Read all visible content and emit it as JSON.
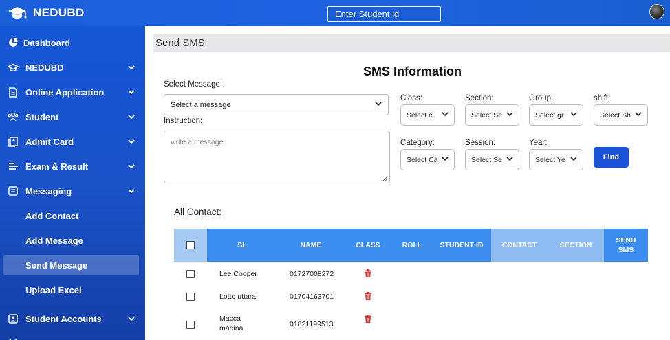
{
  "brand": {
    "name": "NEDUBD",
    "logo_icon": "graduation-cap-icon"
  },
  "search": {
    "placeholder": "Enter Student id"
  },
  "sidebar": {
    "items": [
      {
        "label": "Dashboard",
        "icon": "pie-chart-icon",
        "has_chevron": false
      },
      {
        "label": "NEDUBD",
        "icon": "graduation-cap-icon",
        "has_chevron": true
      },
      {
        "label": "Online Application",
        "icon": "document-icon",
        "has_chevron": true
      },
      {
        "label": "Student",
        "icon": "users-icon",
        "has_chevron": true
      },
      {
        "label": "Admit Card",
        "icon": "card-icon",
        "has_chevron": true
      },
      {
        "label": "Exam & Result",
        "icon": "list-icon",
        "has_chevron": true
      },
      {
        "label": "Messaging",
        "icon": "message-icon",
        "has_chevron": true
      }
    ],
    "subitems": [
      {
        "label": "Add Contact",
        "active": false
      },
      {
        "label": "Add Message",
        "active": false
      },
      {
        "label": "Send Message",
        "active": true
      },
      {
        "label": "Upload Excel",
        "active": false
      }
    ],
    "bottom_item": {
      "label": "Student Accounts",
      "icon": "account-icon"
    }
  },
  "page": {
    "header": "Send SMS",
    "section_title": "SMS Information",
    "select_message_label": "Select Message:",
    "select_message_value": "Select a message",
    "instruction_label": "Instruction:",
    "instruction_placeholder": "write a message",
    "filters": {
      "class": {
        "label": "Class:",
        "value": "Select cl"
      },
      "section": {
        "label": "Section:",
        "value": "Select Se"
      },
      "group": {
        "label": "Group:",
        "value": "Select gr"
      },
      "shift": {
        "label": "shift:",
        "value": "Select Sh"
      },
      "category": {
        "label": "Category:",
        "value": "Select Ca"
      },
      "session": {
        "label": "Session:",
        "value": "Select Se"
      },
      "year": {
        "label": "Year:",
        "value": "Select Ye"
      }
    },
    "find_label": "Find",
    "all_contact_label": "All Contact:"
  },
  "table": {
    "headers": [
      "SL",
      "NAME",
      "CLASS",
      "ROLL",
      "STUDENT ID",
      "CONTACT",
      "SECTION",
      "SEND SMS"
    ],
    "rows": [
      {
        "name": "Lee Cooper",
        "phone": "01727008272"
      },
      {
        "name": "Lotto uttara",
        "phone": "01704163701"
      },
      {
        "name": "Macca madina",
        "phone": "01821199513"
      }
    ]
  },
  "colors": {
    "primary": "#1b53d8",
    "header_blue": "#3b8df0",
    "header_light": "#8fbdf3",
    "delete_red": "#e53935"
  }
}
